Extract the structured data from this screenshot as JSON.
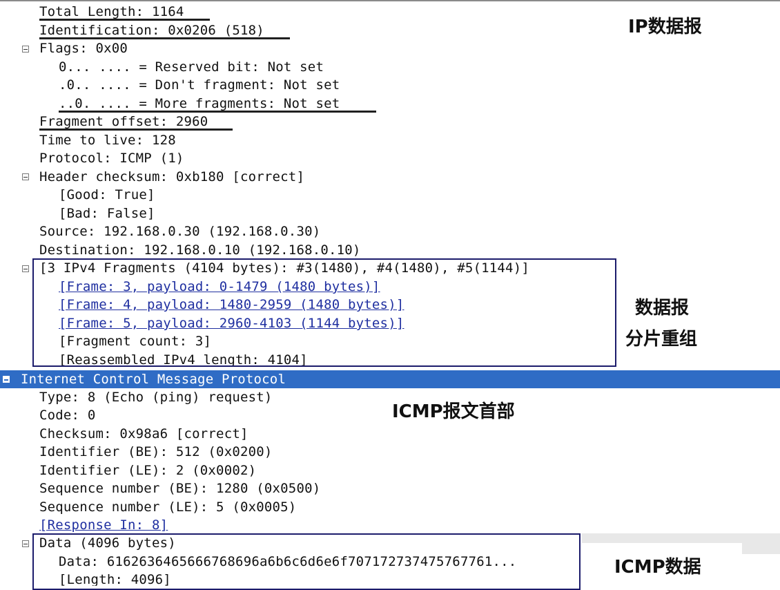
{
  "ip_lines": [
    {
      "text": "Total Length: 1164"
    },
    {
      "text": "Identification: 0x0206 (518)"
    },
    {
      "text": "Flags: 0x00"
    },
    {
      "text": "0... .... = Reserved bit: Not set"
    },
    {
      "text": ".0.. .... = Don't fragment: Not set"
    },
    {
      "text": "..0. .... = More fragments: Not set"
    },
    {
      "text": "Fragment offset: 2960"
    },
    {
      "text": "Time to live: 128"
    },
    {
      "text": "Protocol: ICMP (1)"
    },
    {
      "text": "Header checksum: 0xb180 [correct]"
    },
    {
      "text": "[Good: True]"
    },
    {
      "text": "[Bad: False]"
    },
    {
      "text": "Source: 192.168.0.30 (192.168.0.30)"
    },
    {
      "text": "Destination: 192.168.0.10 (192.168.0.10)"
    },
    {
      "text": "[3 IPv4 Fragments (4104 bytes): #3(1480), #4(1480), #5(1144)]"
    },
    {
      "text": "[Frame: 3, payload: 0-1479 (1480 bytes)]"
    },
    {
      "text": "[Frame: 4, payload: 1480-2959 (1480 bytes)]"
    },
    {
      "text": "[Frame: 5, payload: 2960-4103 (1144 bytes)]"
    },
    {
      "text": "[Fragment count: 3]"
    },
    {
      "text": "[Reassembled IPv4 length: 4104]"
    }
  ],
  "icmp_header": "Internet Control Message Protocol",
  "icmp_lines": [
    {
      "text": "Type: 8 (Echo (ping) request)"
    },
    {
      "text": "Code: 0"
    },
    {
      "text": "Checksum: 0x98a6 [correct]"
    },
    {
      "text": "Identifier (BE): 512 (0x0200)"
    },
    {
      "text": "Identifier (LE): 2 (0x0002)"
    },
    {
      "text": "Sequence number (BE): 1280 (0x0500)"
    },
    {
      "text": "Sequence number (LE): 5 (0x0005)"
    },
    {
      "text": "[Response In: 8]"
    },
    {
      "text": "Data (4096 bytes)"
    },
    {
      "text": "Data: 6162636465666768696a6b6c6d6e6f707172737475767761..."
    },
    {
      "text": "[Length: 4096]"
    }
  ],
  "annotations": {
    "ip_datagram": "IP数据报",
    "reassembly_line1": "数据报",
    "reassembly_line2": "分片重组",
    "icmp_header": "ICMP报文首部",
    "icmp_data": "ICMP数据"
  },
  "colors": {
    "selection": "#2f6cc5",
    "link": "#1f2fa0",
    "box_border": "#1b1b6b"
  }
}
